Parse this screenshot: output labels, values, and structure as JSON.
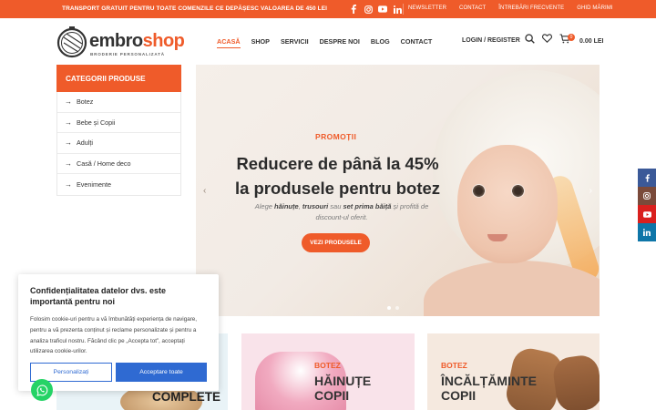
{
  "topbar": {
    "promo": "TRANSPORT GRATUIT PENTRU TOATE COMENZILE CE DEPĂȘESC VALOAREA DE 450 LEI",
    "links": [
      "NEWSLETTER",
      "CONTACT",
      "ÎNTREBĂRI FRECVENTE",
      "GHID MĂRIMI"
    ],
    "socials": [
      "facebook-icon",
      "instagram-icon",
      "youtube-icon",
      "linkedin-icon"
    ]
  },
  "logo": {
    "brand_a": "embro",
    "brand_b": "shop",
    "tagline": "BRODERIE PERSONALIZATĂ"
  },
  "nav": [
    "ACASĂ",
    "SHOP",
    "SERVICII",
    "DESPRE NOI",
    "BLOG",
    "CONTACT"
  ],
  "header": {
    "login": "LOGIN / REGISTER",
    "cart_count": "0",
    "cart_total": "0.00 LEI"
  },
  "categories": {
    "title": "CATEGORII PRODUSE",
    "items": [
      "Botez",
      "Bebe și Copii",
      "Adulți",
      "Casă / Home deco",
      "Evenimente"
    ]
  },
  "hero": {
    "kicker": "PROMOȚII",
    "title": "Reducere de până la 45% la produsele pentru botez",
    "sub_1": "Alege ",
    "sub_b1": "hăinuțe",
    "sub_2": ", ",
    "sub_b2": "trusouri",
    "sub_3": " sau ",
    "sub_b3": "set prima băiță",
    "sub_4": " și profită de discount-ul oferit.",
    "button": "VEZI PRODUSELE"
  },
  "cards": [
    {
      "category": "",
      "title": "COMPLETE"
    },
    {
      "category": "BOTEZ",
      "title": "HĂINUȚE COPII"
    },
    {
      "category": "BOTEZ",
      "title": "ÎNCĂLȚĂMINTE COPII"
    }
  ],
  "cookie": {
    "title": "Confidențialitatea datelor dvs. este importantă pentru noi",
    "body": "Folosim cookie-uri pentru a vă îmbunătăți experiența de navigare, pentru a vă prezenta conținut și reclame personalizate și pentru a analiza traficul nostru. Făcând clic pe „Accepta tot”, acceptați utilizarea cookie-urilor.",
    "customize": "Personalizați",
    "accept": "Acceptare toate"
  },
  "colors": {
    "accent": "#ef5b2a",
    "cookie_blue": "#2f6ad2"
  }
}
